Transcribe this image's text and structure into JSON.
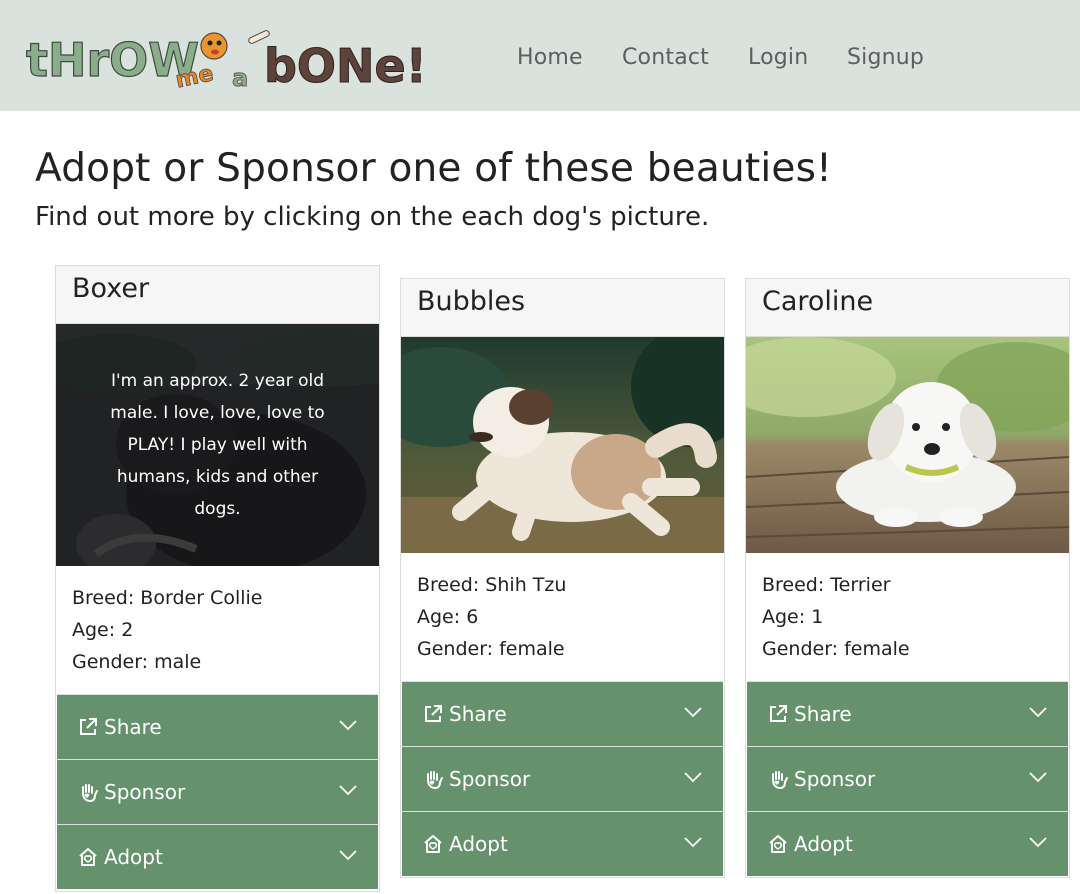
{
  "nav": {
    "logo_text": "throw me a bone!",
    "links": [
      "Home",
      "Contact",
      "Login",
      "Signup"
    ]
  },
  "page": {
    "title": "Adopt or Sponsor one of these beauties!",
    "subtitle": "Find out more by clicking on the each dog's picture."
  },
  "dogs": [
    {
      "name": "Boxer",
      "overlay": "I'm an approx. 2 year old male. I love, love, love to PLAY! I play well with humans, kids and other dogs.",
      "breed": "Breed: Border Collie",
      "age": "Age: 2",
      "gender": "Gender: male"
    },
    {
      "name": "Bubbles",
      "breed": "Breed: Shih Tzu",
      "age": "Age: 6",
      "gender": "Gender: female"
    },
    {
      "name": "Caroline",
      "breed": "Breed: Terrier",
      "age": "Age: 1",
      "gender": "Gender: female"
    }
  ],
  "actions": {
    "share": "Share",
    "sponsor": "Sponsor",
    "adopt": "Adopt"
  },
  "colors": {
    "navbar_bg": "#d9e2dc",
    "accordion_green": "#65926c",
    "logo_green": "#8aae8a",
    "logo_brown": "#5e433c"
  },
  "icons": [
    "share-icon",
    "hand-heart-icon",
    "home-heart-icon",
    "chevron-down-icon"
  ]
}
